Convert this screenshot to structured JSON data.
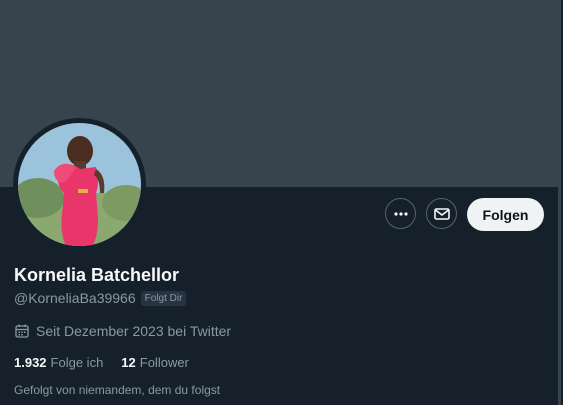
{
  "profile": {
    "display_name": "Kornelia Batchellor",
    "handle": "@KorneliaBa39966",
    "follows_you_badge": "Folgt Dir",
    "joined": "Seit Dezember 2023 bei Twitter",
    "following_count": "1.932",
    "following_label": "Folge ich",
    "followers_count": "12",
    "followers_label": "Follower",
    "followed_by": "Gefolgt von niemandem, dem du folgst"
  },
  "actions": {
    "more_icon": "more-horizontal-icon",
    "message_icon": "mail-icon",
    "follow_label": "Folgen"
  },
  "icons": {
    "joined_icon": "calendar-icon"
  },
  "colors": {
    "background": "#15202b",
    "banner": "#38444d",
    "follow_button": "#eff3f4",
    "secondary_text": "#8b98a5"
  }
}
